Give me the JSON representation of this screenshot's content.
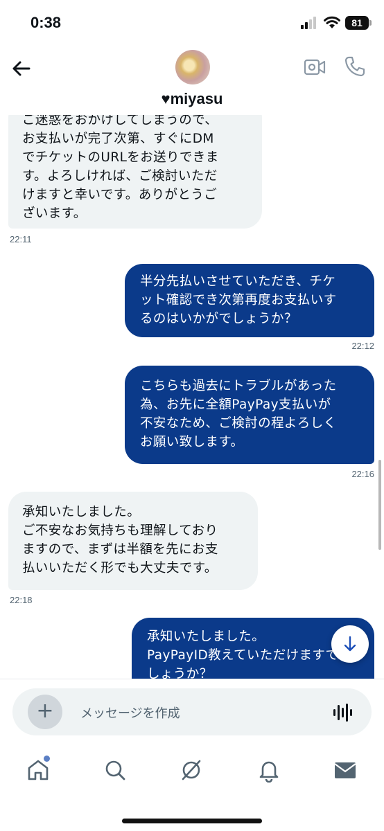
{
  "status_bar": {
    "time": "0:38",
    "battery": "81"
  },
  "header": {
    "name": "miyasu",
    "heart": "♥"
  },
  "messages": [
    {
      "lines": [
        "ご迷惑をおかけしてしまうので、",
        "お支払いが完了次第、すぐにDM",
        "でチケットのURLをお送りできま",
        "す。よろしければ、ご検討いただ",
        "けますと幸いです。ありがとうご",
        "ざいます。"
      ],
      "time": "22:11"
    },
    {
      "lines": [
        "半分先払いさせていただき、チケ",
        "ット確認でき次第再度お支払いす",
        "るのはいかがでしょうか？"
      ],
      "time": "22:12"
    },
    {
      "lines": [
        "こちらも過去にトラブルがあった",
        "為、お先に全額PayPay支払いが",
        "不安なため、ご検討の程よろしく",
        "お願い致します。"
      ],
      "time": "22:16"
    },
    {
      "lines": [
        "承知いたしました。",
        "ご不安なお気持ちも理解しており",
        "ますので、まずは半額を先にお支",
        "払いいただく形でも大丈夫です。"
      ],
      "time": "22:18"
    },
    {
      "lines": [
        "承知いたしました。",
        "PayPayID教えていただけますで",
        "しょうか？"
      ]
    }
  ],
  "composer": {
    "placeholder": "メッセージを作成",
    "add_label": "+"
  },
  "icons": {
    "back": "back-arrow-icon",
    "video": "video-call-icon",
    "phone": "phone-icon",
    "scroll_down": "arrow-down-icon",
    "voice": "voice-waveform-icon",
    "home": "home-icon",
    "search": "search-icon",
    "grok": "grok-icon",
    "notifications": "bell-icon",
    "messages": "mail-icon"
  },
  "colors": {
    "outgoing_bubble": "#0b3a8a",
    "incoming_bubble": "#eff3f4",
    "accent": "#1d4fb8"
  }
}
